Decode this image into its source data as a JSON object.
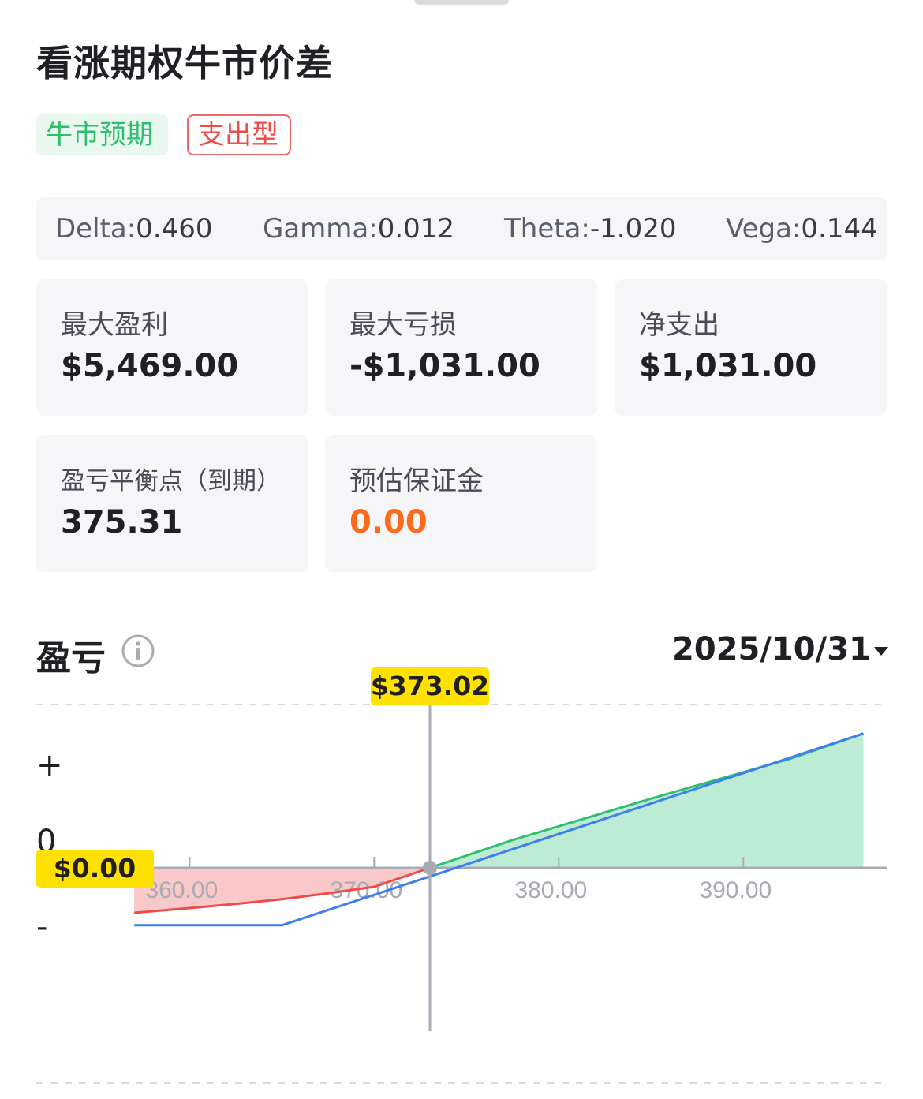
{
  "header": {
    "title": "看涨期权牛市价差",
    "tags": [
      {
        "label": "牛市预期",
        "color": "#2cbf6e"
      },
      {
        "label": "支出型",
        "color": "#ee4b4b"
      }
    ]
  },
  "greeks": [
    {
      "label": "Delta:",
      "value": "0.460"
    },
    {
      "label": "Gamma:",
      "value": "0.012"
    },
    {
      "label": "Theta:",
      "value": "-1.020"
    },
    {
      "label": "Vega:",
      "value": "0.144"
    }
  ],
  "stats": {
    "max_profit": {
      "label": "最大盈利",
      "value": "$5,469.00"
    },
    "max_loss": {
      "label": "最大亏损",
      "value": "-$1,031.00"
    },
    "net_cost": {
      "label": "净支出",
      "value": "$1,031.00"
    },
    "breakeven": {
      "label": "盈亏平衡点（到期）",
      "value": "375.31"
    },
    "margin": {
      "label": "预估保证金",
      "value": "0.00",
      "color": "#ff6a1a"
    }
  },
  "pl_section": {
    "title": "盈亏",
    "info_icon": "info-icon",
    "expiry_date": "2025/10/31",
    "dropdown_icon": "caret-down-icon"
  },
  "chart_data": {
    "type": "line",
    "x_ticks": [
      "360.00",
      "370.00",
      "380.00",
      "390.00"
    ],
    "y_labels": [
      "+",
      "0",
      "-"
    ],
    "current_price_label": "$373.02",
    "current_price": 373.02,
    "zero_label": "$0.00",
    "colors": {
      "today_loss": "#ee4b4b",
      "today_profit": "#2cbf6e",
      "expiry": "#3f7ef0",
      "loss_fill": "#f9c9c9",
      "profit_fill": "#bdecd5",
      "highlight": "#ffe100"
    },
    "series": [
      {
        "style": "today",
        "x": [
          357,
          360,
          362.5,
          365,
          367.5,
          370,
          373.02,
          377.5,
          385,
          392.5,
          396.5
        ],
        "y": [
          -7.6,
          -6.8,
          -6.1,
          -5.3,
          -4.3,
          -3.2,
          0,
          4.7,
          11.7,
          18.4,
          22.7
        ]
      },
      {
        "style": "expiry",
        "x": [
          357,
          365,
          396.5
        ],
        "y": [
          -9.7,
          -9.7,
          22.7
        ]
      }
    ]
  }
}
